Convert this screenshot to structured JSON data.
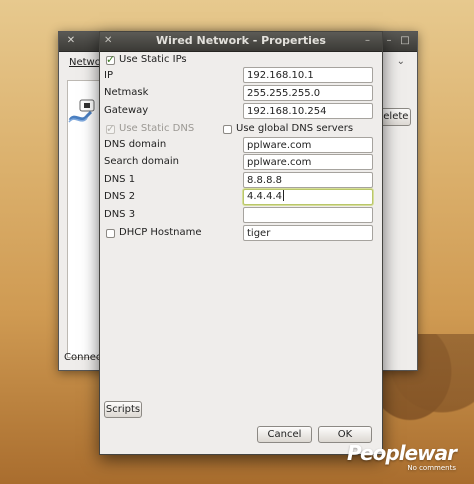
{
  "background_window": {
    "tab_label": "Netwo",
    "delete_label": "Delete",
    "status_label": "Connect"
  },
  "dialog": {
    "title": "Wired Network - Properties",
    "use_static_ips_label": "Use Static IPs",
    "use_static_ips_checked": true,
    "ip": {
      "label": "IP",
      "value": "192.168.10.1"
    },
    "netmask": {
      "label": "Netmask",
      "value": "255.255.255.0"
    },
    "gateway": {
      "label": "Gateway",
      "value": "192.168.10.254"
    },
    "use_static_dns_label": "Use Static DNS",
    "use_static_dns_checked": true,
    "use_global_dns_label": "Use global DNS servers",
    "use_global_dns_checked": false,
    "dns_domain": {
      "label": "DNS domain",
      "value": "pplware.com"
    },
    "search_domain": {
      "label": "Search domain",
      "value": "pplware.com"
    },
    "dns1": {
      "label": "DNS 1",
      "value": "8.8.8.8"
    },
    "dns2": {
      "label": "DNS 2",
      "value": "4.4.4.4"
    },
    "dns3": {
      "label": "DNS 3",
      "value": ""
    },
    "dhcp_hostname": {
      "label": "DHCP Hostname",
      "value": "tiger",
      "checked": false
    },
    "scripts_label": "Scripts",
    "cancel_label": "Cancel",
    "ok_label": "OK"
  },
  "watermark": {
    "main": "Peoplewar",
    "sub": "No comments"
  },
  "colors": {
    "titlebar": "#3d3c38",
    "dialog_bg": "#efedeb",
    "focus_ring": "#b9c66a",
    "check": "#3b7a1f"
  }
}
